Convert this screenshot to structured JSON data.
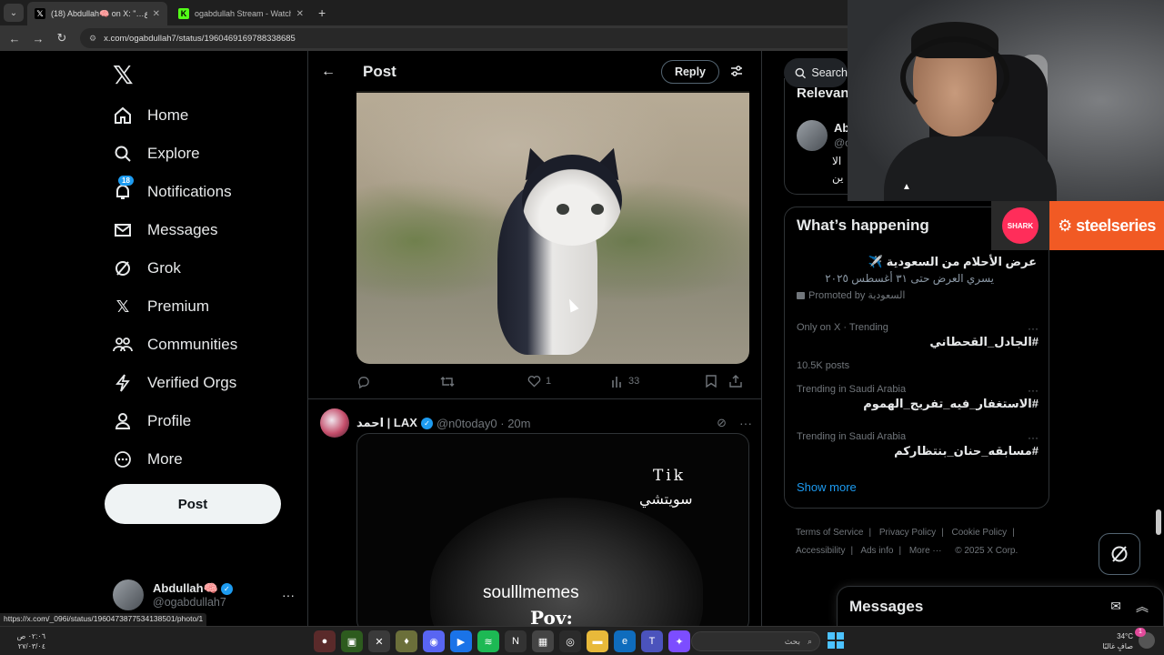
{
  "browser": {
    "tabs": [
      {
        "title": "(18) Abdullah🧠 on X: \"…قرآن ع\"",
        "favicon": "x-icon",
        "active": true
      },
      {
        "title": "ogabdullah Stream - Watch Live",
        "favicon": "kick-icon",
        "active": false
      }
    ],
    "new_tab": "+",
    "url": "x.com/ogabdullah7/status/1960469169788338685",
    "status_url": "https://x.com/_096i/status/1960473877534138501/photo/1"
  },
  "nav": {
    "items": [
      {
        "label": "Home",
        "icon": "home-icon"
      },
      {
        "label": "Explore",
        "icon": "search-icon"
      },
      {
        "label": "Notifications",
        "icon": "bell-icon",
        "badge": "18"
      },
      {
        "label": "Messages",
        "icon": "envelope-icon"
      },
      {
        "label": "Grok",
        "icon": "grok-icon"
      },
      {
        "label": "Premium",
        "icon": "x-icon"
      },
      {
        "label": "Communities",
        "icon": "people-icon"
      },
      {
        "label": "Verified Orgs",
        "icon": "lightning-icon"
      },
      {
        "label": "Profile",
        "icon": "person-icon"
      },
      {
        "label": "More",
        "icon": "more-circle-icon"
      }
    ],
    "post_button": "Post",
    "account": {
      "name": "Abdullah🧠",
      "handle": "@ogabdullah7",
      "more": "···"
    }
  },
  "center": {
    "header_title": "Post",
    "reply_button": "Reply",
    "actions": {
      "replies": "",
      "reposts": "",
      "likes": "1",
      "views": "33"
    },
    "tweet2": {
      "name": "احمد | LAX",
      "handle": "@n0today0",
      "time": "· 20m",
      "media_text_1": "Tik",
      "media_text_2": "سويتشي",
      "media_text_3": "soulllmemes",
      "media_text_4": "Pov:"
    }
  },
  "right": {
    "search_label": "Search",
    "relevant": {
      "title": "Relevant",
      "name": "Ab",
      "handle": "@o",
      "line1": "الا",
      "line2": "ين"
    },
    "happening": {
      "title": "What’s happening",
      "promo_title": "عرض الأحلام من السعودية ✈️",
      "promo_sub": "يسري العرض حتى ٣١ أغسطس ٢٠٢٥",
      "promo_by": "Promoted by السعودية",
      "trends": [
        {
          "meta": "Only on X · Trending",
          "name": "#الجادل_القحطاني",
          "count": "10.5K posts"
        },
        {
          "meta": "Trending in Saudi Arabia",
          "name": "#الاستغفار_فيه_تفريج_الهموم",
          "count": ""
        },
        {
          "meta": "Trending in Saudi Arabia",
          "name": "#مسابقه_حنان_بنتظاركم",
          "count": ""
        }
      ],
      "show_more": "Show more"
    },
    "footer": {
      "links": [
        "Terms of Service",
        "Privacy Policy",
        "Cookie Policy",
        "Accessibility",
        "Ads info",
        "More ···"
      ],
      "copyright": "© 2025 X Corp."
    },
    "messages_title": "Messages"
  },
  "overlay": {
    "steelseries": "steelseries",
    "badge_text": "SHARK"
  },
  "taskbar": {
    "clock_time": "٠٢:٠٦ ص",
    "clock_date": "٢٧/٠٣/٠٤",
    "search_placeholder": "بحث",
    "weather_temp": "34°C",
    "weather_desc": "صافٍ غالبًا",
    "notif_count": "1"
  },
  "colors": {
    "accent": "#1d9bf0",
    "bg": "#000000",
    "border": "#2f3336",
    "steelseries": "#f15a24"
  }
}
